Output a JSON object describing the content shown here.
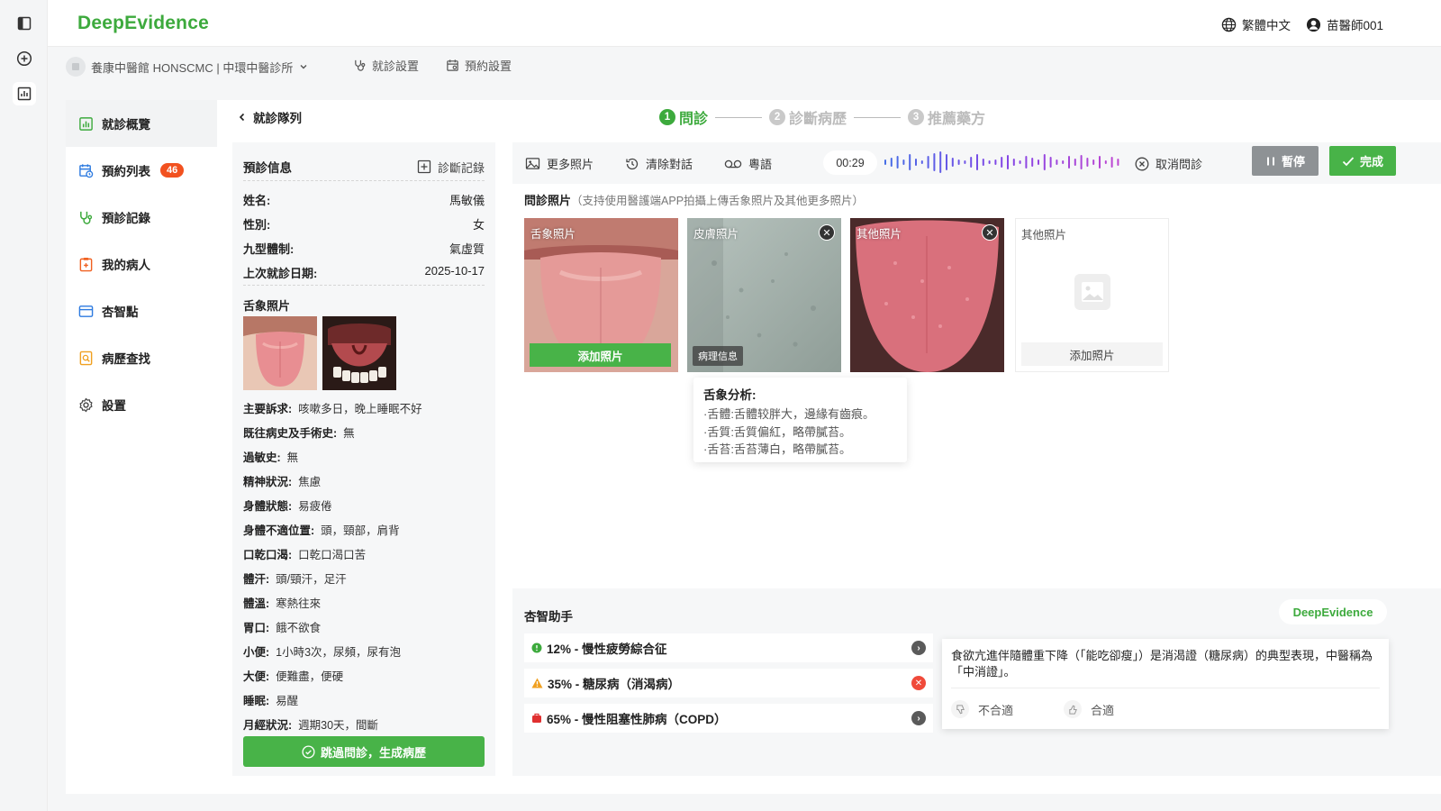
{
  "app": {
    "brand": "DeepEvidence",
    "language": "繁體中文",
    "user": "苗醫師001"
  },
  "subbar": {
    "clinic": "養康中醫館 HONSCMC | 中環中醫診所",
    "consult_settings": "就診設置",
    "booking_settings": "預約設置"
  },
  "sidebar": {
    "items": [
      {
        "label": "就診概覽"
      },
      {
        "label": "預約列表",
        "badge": "46"
      },
      {
        "label": "預診記錄"
      },
      {
        "label": "我的病人"
      },
      {
        "label": "杏智點"
      },
      {
        "label": "病歷查找"
      },
      {
        "label": "設置"
      }
    ]
  },
  "header": {
    "back_label": "就診隊列",
    "steps": [
      {
        "num": "1",
        "label": "問診"
      },
      {
        "num": "2",
        "label": "診斷病歷"
      },
      {
        "num": "3",
        "label": "推薦藥方"
      }
    ]
  },
  "prediag": {
    "title": "預診信息",
    "record_label": "診斷記錄",
    "fields": [
      {
        "k": "姓名:",
        "v": "馬敏儀"
      },
      {
        "k": "性別:",
        "v": "女"
      },
      {
        "k": "九型體制:",
        "v": "氣虛質"
      },
      {
        "k": "上次就診日期:",
        "v": "2025-10-17"
      }
    ],
    "tongue_title": "舌象照片",
    "history": [
      {
        "k": "主要訴求:",
        "v": "咳嗽多日，晚上睡眠不好"
      },
      {
        "k": "既往病史及手術史:",
        "v": "無"
      },
      {
        "k": "過敏史:",
        "v": "無"
      },
      {
        "k": "精神狀況:",
        "v": "焦慮"
      },
      {
        "k": "身體狀態:",
        "v": "易疲倦"
      },
      {
        "k": "身體不適位置:",
        "v": "頭，頸部，肩背"
      },
      {
        "k": "口乾口渴:",
        "v": "口乾口渴口苦"
      },
      {
        "k": "體汗:",
        "v": "頭/頸汗，足汗"
      },
      {
        "k": "體溫:",
        "v": "寒熱往來"
      },
      {
        "k": "胃口:",
        "v": "餓不欲食"
      },
      {
        "k": "小便:",
        "v": "1小時3次，尿頻，尿有泡"
      },
      {
        "k": "大便:",
        "v": "便難盡，便硬"
      },
      {
        "k": "睡眠:",
        "v": "易醒"
      },
      {
        "k": "月經狀況:",
        "v": "週期30天，間斷"
      }
    ],
    "generate_button": "跳過問診，生成病歷"
  },
  "toolbar": {
    "more_photos": "更多照片",
    "clear_chat": "清除對話",
    "dialect": "粵語",
    "timer": "00:29",
    "cancel": "取消問診",
    "pause": "暫停",
    "done": "完成"
  },
  "photos": {
    "title": "問診照片",
    "hint": "（支持使用醫護端APP拍攝上傳舌象照片及其他更多照片）",
    "cards": [
      {
        "label": "舌象照片",
        "action": "添加照片"
      },
      {
        "label": "皮膚照片",
        "tag": "病理信息"
      },
      {
        "label": "其他照片"
      },
      {
        "label": "其他照片",
        "action": "添加照片"
      }
    ]
  },
  "tongue_analysis": {
    "title": "舌象分析:",
    "lines": [
      "·舌體:舌體较胖大，邊緣有齒痕。",
      "·舌質:舌質偏紅，略帶膩苔。",
      "·舌苔:舌苔薄白，略帶膩苔。"
    ]
  },
  "assistant": {
    "title": "杏智助手",
    "brand": "DeepEvidence",
    "diagnoses": [
      {
        "text": "12% - 慢性疲勞綜合征",
        "color": "#3daa3d"
      },
      {
        "text": "35% - 糖尿病（消渴病）",
        "color": "#f0a020"
      },
      {
        "text": "65% - 慢性阻塞性肺病（COPD）",
        "color": "#e03030"
      }
    ],
    "explanation": "食欲亢進伴隨體重下降（「能吃卻瘦」）是消渴證（糖尿病）的典型表現，中醫稱為「中消證」。",
    "feedback": {
      "bad": "不合適",
      "good": "合適"
    }
  }
}
